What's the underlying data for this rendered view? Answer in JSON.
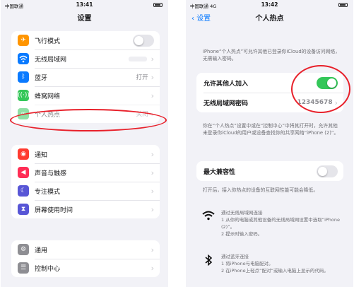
{
  "left_screen": {
    "status": {
      "carrier": "中国联通",
      "time": "13:41"
    },
    "nav_title": "设置",
    "group1": [
      {
        "label": "飞行模式",
        "icon": "airplane-icon",
        "color": "#ff9500",
        "toggle": "off"
      },
      {
        "label": "无线局域网",
        "icon": "wifi-icon",
        "color": "#0a7aff",
        "value": ""
      },
      {
        "label": "蓝牙",
        "icon": "bluetooth-icon",
        "color": "#0a7aff",
        "value": "打开"
      },
      {
        "label": "蜂窝网络",
        "icon": "cellular-icon",
        "color": "#34c759"
      },
      {
        "label": "个人热点",
        "icon": "hotspot-icon",
        "color": "#34c759",
        "value": "关闭"
      }
    ],
    "group2": [
      {
        "label": "通知",
        "icon": "bell-icon",
        "color": "#ff3b30"
      },
      {
        "label": "声音与触感",
        "icon": "speaker-icon",
        "color": "#ff2d55"
      },
      {
        "label": "专注模式",
        "icon": "moon-icon",
        "color": "#5856d6"
      },
      {
        "label": "屏幕使用时间",
        "icon": "hourglass-icon",
        "color": "#5856d6"
      }
    ],
    "group3": [
      {
        "label": "通用",
        "icon": "gear-icon",
        "color": "#8e8e93"
      },
      {
        "label": "控制中心",
        "icon": "switches-icon",
        "color": "#8e8e93"
      }
    ]
  },
  "right_screen": {
    "status": {
      "carrier": "中国联通",
      "network": "4G",
      "time": "13:42"
    },
    "back_label": "设置",
    "nav_title": "个人热点",
    "intro_note": "iPhone“个人热点”可允许其他已登录你iCloud的设备访问网络，无需输入密码。",
    "allow_others_label": "允许其他人加入",
    "allow_others_toggle": "on",
    "wlan_password_label": "无线局域网密码",
    "wlan_password_value": "12345678",
    "middle_note": "你在“个人热点”设置中或在“控制中心”中将其打开时，允许其他未登录你iCloud的用户或设备查找你的共享网络“iPhone (2)”。",
    "max_compat_label": "最大兼容性",
    "max_compat_toggle": "off",
    "compat_note": "打开后，接入你热点的设备的互联网性能可能会降低。",
    "wifi_heading": "通过无线局域网连接",
    "wifi_step1": "1 从你的电脑或其他设备的无线局域网设置中选取“iPhone (2)”。",
    "wifi_step2": "2 提示时输入密码。",
    "bt_heading": "通过蓝牙连接",
    "bt_step1": "1 将iPhone与电脑配对。",
    "bt_step2": "2 在iPhone上轻点“配对”或输入电脑上显示的代码。"
  },
  "colors": {
    "highlight": "#e8202a",
    "toggle_on": "#34c759",
    "link": "#0a7aff"
  }
}
